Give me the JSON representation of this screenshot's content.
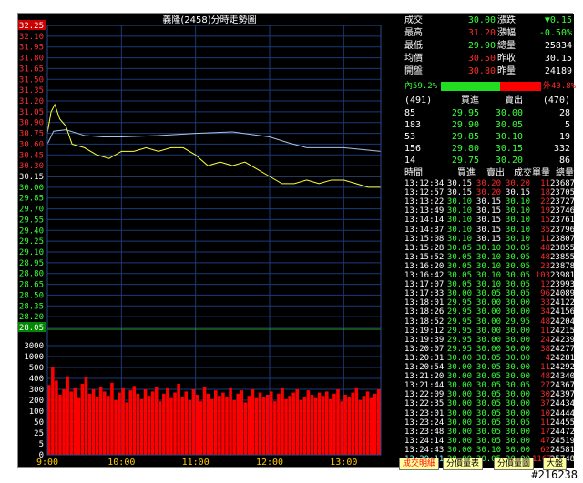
{
  "chart_data": {
    "type": "line",
    "title": "義隆(2458)分時走勢圖",
    "price_ticks": [
      "32.25",
      "32.10",
      "31.95",
      "31.80",
      "31.65",
      "31.50",
      "31.35",
      "31.20",
      "31.05",
      "30.90",
      "30.75",
      "30.60",
      "30.45",
      "30.30",
      "30.15",
      "30.00",
      "29.85",
      "29.70",
      "29.55",
      "29.40",
      "29.25",
      "29.10",
      "28.95",
      "28.80",
      "28.65",
      "28.50",
      "28.35",
      "28.20",
      "28.05"
    ],
    "price_range": [
      28.05,
      32.25
    ],
    "ref_price": 30.15,
    "volume_ticks": [
      "3000",
      "1000",
      "500",
      "400",
      "300",
      "200",
      "100",
      "50",
      "25",
      "5",
      "0"
    ],
    "time_ticks": [
      "9:00",
      "10:00",
      "11:00",
      "12:00",
      "13:00"
    ],
    "series": [
      {
        "name": "成交",
        "color": "#ffff3a",
        "x": [
          "9:00",
          "9:03",
          "9:06",
          "9:10",
          "9:15",
          "9:20",
          "9:30",
          "9:40",
          "9:50",
          "10:00",
          "10:10",
          "10:20",
          "10:30",
          "10:40",
          "10:50",
          "11:00",
          "11:10",
          "11:20",
          "11:30",
          "11:40",
          "11:50",
          "12:00",
          "12:10",
          "12:20",
          "12:30",
          "12:40",
          "12:50",
          "13:00",
          "13:10",
          "13:20",
          "13:30"
        ],
        "values": [
          30.75,
          31.05,
          31.15,
          30.95,
          30.85,
          30.6,
          30.55,
          30.45,
          30.4,
          30.5,
          30.5,
          30.55,
          30.5,
          30.55,
          30.55,
          30.45,
          30.3,
          30.35,
          30.3,
          30.35,
          30.25,
          30.15,
          30.05,
          30.05,
          30.1,
          30.05,
          30.1,
          30.1,
          30.05,
          30.0,
          30.0
        ]
      },
      {
        "name": "均價",
        "color": "#a9c4e8",
        "x": [
          "9:00",
          "9:05",
          "9:15",
          "9:30",
          "9:45",
          "10:00",
          "10:30",
          "11:00",
          "11:30",
          "12:00",
          "12:15",
          "12:30",
          "13:00",
          "13:30"
        ],
        "values": [
          30.6,
          30.78,
          30.8,
          30.72,
          30.7,
          30.7,
          30.72,
          30.75,
          30.77,
          30.7,
          30.62,
          30.55,
          30.55,
          30.5
        ]
      }
    ],
    "volume": {
      "color": "#ff0000",
      "values": [
        340,
        520,
        380,
        250,
        300,
        420,
        280,
        310,
        220,
        350,
        410,
        260,
        300,
        230,
        320,
        280,
        240,
        360,
        200,
        270,
        310,
        180,
        290,
        330,
        260,
        210,
        300,
        240,
        280,
        320,
        190,
        260,
        310,
        220,
        270,
        350,
        230,
        280,
        200,
        300,
        250,
        190,
        320,
        260,
        210,
        290,
        240,
        270,
        230,
        310,
        200,
        260,
        290,
        180,
        240,
        300,
        220,
        270,
        230,
        250,
        280,
        190,
        260,
        310,
        210,
        240,
        270,
        300,
        200,
        230,
        290,
        250,
        220,
        270,
        240,
        280,
        210,
        260,
        300,
        190,
        250,
        230,
        270,
        310,
        200,
        240,
        280,
        220,
        260,
        300
      ]
    }
  },
  "quote": {
    "l1": "成交",
    "v1": "30.00",
    "l1b": "漲跌",
    "v1b": "▼0.15",
    "l2": "最高",
    "v2": "31.20",
    "l2b": "漲幅",
    "v2b": "-0.50%",
    "l3": "最低",
    "v3": "29.90",
    "l3b": "總量",
    "v3b": "25834",
    "l4": "均價",
    "v4": "30.50",
    "l4b": "昨收",
    "v4b": "30.15",
    "l5": "開盤",
    "v5": "30.80",
    "l5b": "昨量",
    "v5b": "24189",
    "inner": "內59.2%",
    "outer": "外40.8%",
    "inner_frac": 0.592
  },
  "book": {
    "left_count": "(491)",
    "h_bid": "買進",
    "h_ask": "賣出",
    "right_count": "(470)",
    "rows": [
      {
        "bq": "85",
        "bp": "29.95",
        "ap": "30.00",
        "aq": "28"
      },
      {
        "bq": "183",
        "bp": "29.90",
        "ap": "30.05",
        "aq": "5"
      },
      {
        "bq": "53",
        "bp": "29.85",
        "ap": "30.10",
        "aq": "19"
      },
      {
        "bq": "156",
        "bp": "29.80",
        "ap": "30.15",
        "aq": "332"
      },
      {
        "bq": "14",
        "bp": "29.75",
        "ap": "30.20",
        "aq": "86"
      }
    ]
  },
  "ticks_header": {
    "t": "時間",
    "b": "買進",
    "a": "賣出",
    "p": "成交",
    "q": "單量",
    "v": "總量"
  },
  "ticks": [
    {
      "t": "13:12:34",
      "b": "30.15",
      "a": "30.20",
      "p": "30.20",
      "q": "11",
      "v": "23687"
    },
    {
      "t": "13:12:57",
      "b": "30.15",
      "a": "30.20",
      "p": "30.15",
      "q": "18",
      "v": "23705"
    },
    {
      "t": "13:13:22",
      "b": "30.10",
      "a": "30.15",
      "p": "30.10",
      "q": "22",
      "v": "23727"
    },
    {
      "t": "13:13:49",
      "b": "30.10",
      "a": "30.15",
      "p": "30.10",
      "q": "19",
      "v": "23746"
    },
    {
      "t": "13:14:14",
      "b": "30.10",
      "a": "30.15",
      "p": "30.10",
      "q": "15",
      "v": "23761"
    },
    {
      "t": "13:14:37",
      "b": "30.10",
      "a": "30.15",
      "p": "30.10",
      "q": "35",
      "v": "23796"
    },
    {
      "t": "13:15:08",
      "b": "30.10",
      "a": "30.15",
      "p": "30.10",
      "q": "11",
      "v": "23807"
    },
    {
      "t": "13:15:28",
      "b": "30.05",
      "a": "30.10",
      "p": "30.05",
      "q": "48",
      "v": "23855"
    },
    {
      "t": "13:15:52",
      "b": "30.05",
      "a": "30.10",
      "p": "30.05",
      "q": "48",
      "v": "23855"
    },
    {
      "t": "13:16:20",
      "b": "30.05",
      "a": "30.10",
      "p": "30.05",
      "q": "23",
      "v": "23878"
    },
    {
      "t": "13:16:42",
      "b": "30.05",
      "a": "30.10",
      "p": "30.05",
      "q": "103",
      "v": "23981"
    },
    {
      "t": "13:17:07",
      "b": "30.05",
      "a": "30.10",
      "p": "30.05",
      "q": "12",
      "v": "23993"
    },
    {
      "t": "13:17:33",
      "b": "30.00",
      "a": "30.05",
      "p": "30.05",
      "q": "96",
      "v": "24089"
    },
    {
      "t": "13:18:01",
      "b": "29.95",
      "a": "30.00",
      "p": "30.00",
      "q": "33",
      "v": "24122"
    },
    {
      "t": "13:18:26",
      "b": "29.95",
      "a": "30.00",
      "p": "30.00",
      "q": "34",
      "v": "24156"
    },
    {
      "t": "13:18:52",
      "b": "29.95",
      "a": "30.00",
      "p": "29.95",
      "q": "48",
      "v": "24204"
    },
    {
      "t": "13:19:12",
      "b": "29.95",
      "a": "30.00",
      "p": "30.00",
      "q": "11",
      "v": "24215"
    },
    {
      "t": "13:19:39",
      "b": "29.95",
      "a": "30.00",
      "p": "30.00",
      "q": "24",
      "v": "24239"
    },
    {
      "t": "13:20:07",
      "b": "29.95",
      "a": "30.00",
      "p": "30.00",
      "q": "38",
      "v": "24277"
    },
    {
      "t": "13:20:31",
      "b": "30.00",
      "a": "30.05",
      "p": "30.00",
      "q": "4",
      "v": "24281"
    },
    {
      "t": "13:20:54",
      "b": "30.00",
      "a": "30.05",
      "p": "30.00",
      "q": "11",
      "v": "24292"
    },
    {
      "t": "13:21:20",
      "b": "30.00",
      "a": "30.05",
      "p": "30.00",
      "q": "48",
      "v": "24340"
    },
    {
      "t": "13:21:44",
      "b": "30.00",
      "a": "30.05",
      "p": "30.05",
      "q": "27",
      "v": "24367"
    },
    {
      "t": "13:22:09",
      "b": "30.00",
      "a": "30.05",
      "p": "30.00",
      "q": "30",
      "v": "24397"
    },
    {
      "t": "13:22:35",
      "b": "30.00",
      "a": "30.05",
      "p": "30.00",
      "q": "37",
      "v": "24434"
    },
    {
      "t": "13:23:01",
      "b": "30.00",
      "a": "30.05",
      "p": "30.00",
      "q": "10",
      "v": "24444"
    },
    {
      "t": "13:23:24",
      "b": "30.00",
      "a": "30.05",
      "p": "30.05",
      "q": "11",
      "v": "24455"
    },
    {
      "t": "13:23:48",
      "b": "30.00",
      "a": "30.05",
      "p": "30.00",
      "q": "17",
      "v": "24472"
    },
    {
      "t": "13:24:14",
      "b": "30.00",
      "a": "30.05",
      "p": "30.00",
      "q": "47",
      "v": "24519"
    },
    {
      "t": "13:24:43",
      "b": "30.00",
      "a": "30.10",
      "p": "30.00",
      "q": "62",
      "v": "24581"
    },
    {
      "t": "13:30:11",
      "b": "30.00",
      "a": "30.05",
      "p": "30.00",
      "q": "1167",
      "v": "25748"
    }
  ],
  "buttons": {
    "b1": "成交明細",
    "b2": "分價量表",
    "b3": "分價量圖",
    "b4": "大盤"
  },
  "watermark": "#216238"
}
